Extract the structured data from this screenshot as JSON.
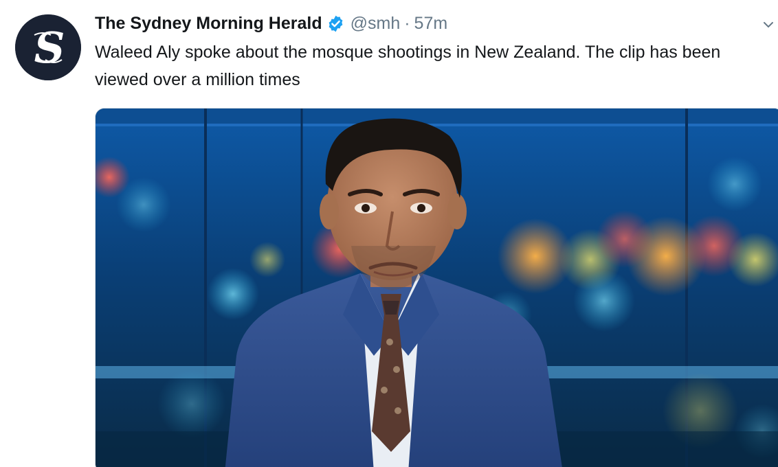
{
  "author": {
    "display_name": "The Sydney Morning Herald",
    "handle": "@smh",
    "separator": "·",
    "time": "57m",
    "avatar_icon": "smh-s-logo-icon",
    "verified_icon": "verified-badge-icon"
  },
  "tweet": {
    "text": "Waleed Aly spoke about the mosque shootings in New Zealand. The clip has been viewed over a million times"
  },
  "menu": {
    "icon": "chevron-down-icon"
  },
  "media": {
    "kind": "video-still",
    "description_icon": "news-anchor-image"
  },
  "colors": {
    "verified_blue": "#1da1f2",
    "secondary_text": "#657786",
    "avatar_bg": "#1a2233"
  }
}
